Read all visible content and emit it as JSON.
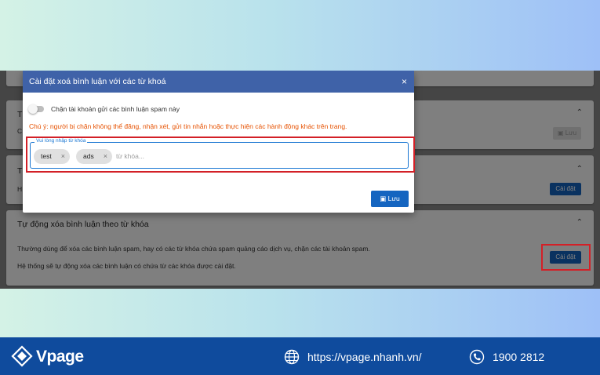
{
  "cards": {
    "card2": {
      "title": "T",
      "text": "C",
      "save_label": "Lưu"
    },
    "card3": {
      "title": "T",
      "text": "H",
      "button_label": "Cài đặt"
    },
    "card4": {
      "title": "Tự động xóa bình luận theo từ khóa",
      "line1": "Thường dùng để xóa các bình luận spam, hay có các từ khóa chứa spam quảng cáo dịch vụ, chặn các tài khoản spam.",
      "line2": "Hệ thống sẽ tự động xóa các bình luận có chứa từ các khóa được cài đặt.",
      "button_label": "Cài đặt"
    }
  },
  "dialog": {
    "title": "Cài đặt xoá bình luận với các từ khoá",
    "close_label": "×",
    "toggle_label": "Chặn tài khoản gửi các bình luận spam này",
    "warning": "Chú ý: người bị chặn không thể đăng, nhận xét, gửi tin nhắn hoặc thực hiện các hành động khác trên trang.",
    "field_label": "Vui lòng nhập từ khóa",
    "chips": [
      "test",
      "ads"
    ],
    "chip_remove": "×",
    "placeholder": "từ khóa...",
    "save_label": "Lưu"
  },
  "footer": {
    "brand": "Vpage",
    "url": "https://vpage.nhanh.vn/",
    "phone": "1900 2812"
  },
  "colors": {
    "primary": "#1565c0",
    "dialog_header": "#3f62a8",
    "warning": "#e65100",
    "highlight": "#d32027",
    "footer": "#0f4b9d"
  }
}
